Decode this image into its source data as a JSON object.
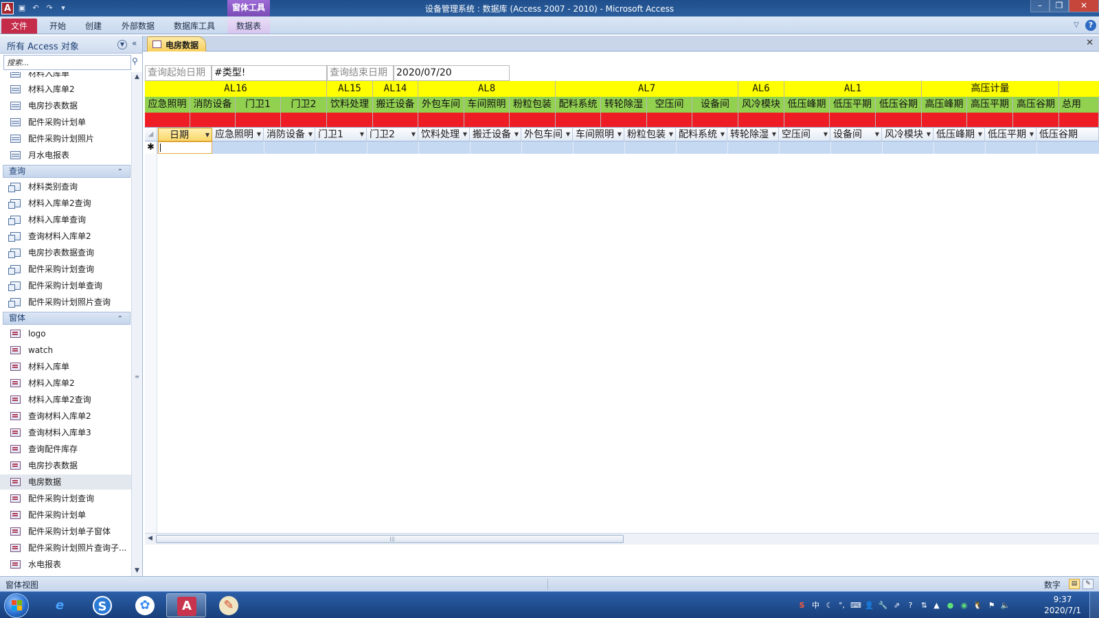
{
  "window": {
    "title": "设备管理系统 : 数据库 (Access 2007 - 2010)  -  Microsoft Access",
    "context_tab_header": "窗体工具",
    "app_icon": "A"
  },
  "ribbon": {
    "tabs": [
      "文件",
      "开始",
      "创建",
      "外部数据",
      "数据库工具",
      "数据表"
    ],
    "help": "?"
  },
  "nav": {
    "title": "所有 Access 对象",
    "search_placeholder": "搜索...",
    "tables": [
      "材料入库单",
      "材料入库单2",
      "电房抄表数据",
      "配件采购计划单",
      "配件采购计划照片",
      "月水电报表"
    ],
    "queries_header": "查询",
    "queries": [
      "材料类别查询",
      "材料入库单2查询",
      "材料入库单查询",
      "查询材料入库单2",
      "电房抄表数据查询",
      "配件采购计划查询",
      "配件采购计划单查询",
      "配件采购计划照片查询"
    ],
    "forms_header": "窗体",
    "forms": [
      "logo",
      "watch",
      "材料入库单",
      "材料入库单2",
      "材料入库单2查询",
      "查询材料入库单2",
      "查询材料入库单3",
      "查询配件库存",
      "电房抄表数据",
      "电房数据",
      "配件采购计划查询",
      "配件采购计划单",
      "配件采购计划单子窗体",
      "配件采购计划照片查询子...",
      "水电报表"
    ],
    "selected_form": "电房数据"
  },
  "document": {
    "tab_label": "电房数据"
  },
  "query": {
    "start_label": "查询起始日期",
    "start_value": "#类型!",
    "end_label": "查询结束日期",
    "end_value": "2020/07/20"
  },
  "bands": {
    "groups": [
      "AL16",
      "AL15",
      "AL14",
      "AL8",
      "AL7",
      "AL6",
      "AL1",
      "高压计量"
    ],
    "fields": [
      "应急照明",
      "消防设备",
      "门卫1",
      "门卫2",
      "饮料处理",
      "搬迁设备",
      "外包车间",
      "车间照明",
      "粉粒包装",
      "配料系统",
      "转轮除湿",
      "空压间",
      "设备间",
      "风冷模块",
      "低压峰期",
      "低压平期",
      "低压谷期",
      "高压峰期",
      "高压平期",
      "高压谷期",
      "总用"
    ]
  },
  "datasheet": {
    "columns": [
      "日期",
      "应急照明",
      "消防设备",
      "门卫1",
      "门卫2",
      "饮料处理",
      "搬迁设备",
      "外包车间",
      "车间照明",
      "粉粒包装",
      "配料系统",
      "转轮除湿",
      "空压间",
      "设备间",
      "风冷模块",
      "低压峰期",
      "低压平期",
      "低压谷期"
    ],
    "new_row_marker": "✱"
  },
  "statusbar": {
    "left": "窗体视图",
    "right": "数字"
  },
  "taskbar": {
    "time": "9:37",
    "date": "2020/7/1",
    "ime": "中"
  },
  "colors": {
    "yellow_band": "#ffff00",
    "green_band": "#92d050",
    "red_band": "#ee1c24",
    "file_tab": "#c42c4a"
  }
}
